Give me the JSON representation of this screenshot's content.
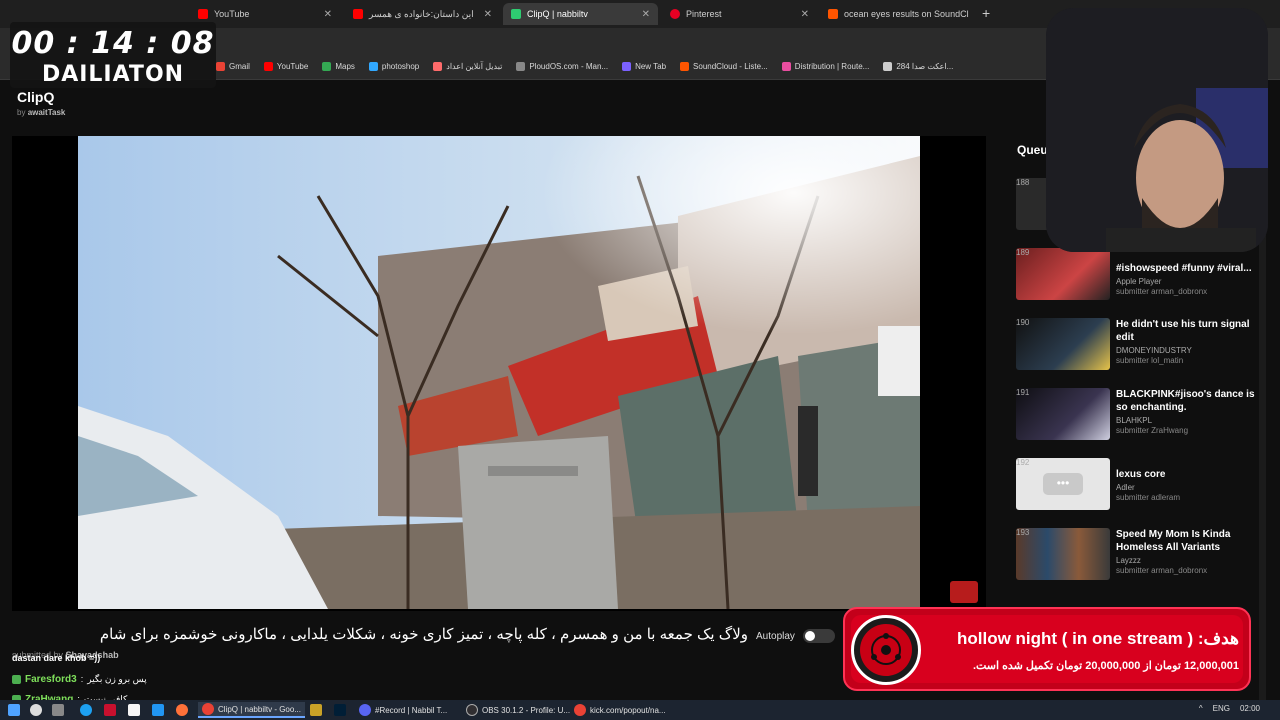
{
  "tabs": [
    {
      "label": "YouTube",
      "color": "#ff0000"
    },
    {
      "label": "این داستان:خانواده ی همسر",
      "color": "#ff0000"
    },
    {
      "label": "ClipQ | nabbiltv",
      "color": "#2ecc71",
      "active": true
    },
    {
      "label": "Pinterest",
      "color": "#e60023"
    },
    {
      "label": "ocean eyes results on SoundCl",
      "color": "#ff5500"
    }
  ],
  "bookmarks": [
    {
      "label": "Gmail",
      "color": "#ea4335"
    },
    {
      "label": "YouTube",
      "color": "#ff0000"
    },
    {
      "label": "Maps",
      "color": "#34a853"
    },
    {
      "label": "photoshop",
      "color": "#31a8ff"
    },
    {
      "label": "تبدیل آنلاین اعداد",
      "color": "#ff6b6b"
    },
    {
      "label": "PloudOS.com - Man...",
      "color": "#888888"
    },
    {
      "label": "New Tab",
      "color": "#7b61ff"
    },
    {
      "label": "SoundCloud - Liste...",
      "color": "#ff5500"
    },
    {
      "label": "Distribution | Route...",
      "color": "#e94ea0"
    },
    {
      "label": "284 اعکت صدا...",
      "color": "#cccccc"
    }
  ],
  "timer": {
    "time": "00 : 14 : 08",
    "label": "DAILIATON"
  },
  "app": {
    "title": "ClipQ",
    "by_prefix": "by",
    "by_user": "awaitTask"
  },
  "video": {
    "title": "ولاگ یک جمعه با من و همسرم ، کله پاچه ، تمیز کاری خونه ، شکلات یلدایی ، ماکارونی خوشمزه برای شام",
    "autoplay_label": "Autoplay",
    "submitted_text": "submitted by",
    "submitted_user": "Shayadshab"
  },
  "chat": [
    {
      "name": "",
      "text": "dastan dare khob =))"
    },
    {
      "name": "Faresford3",
      "text": "پس برو زن بگیر"
    },
    {
      "name": "ZraHwang",
      "text": "کافی نیست"
    }
  ],
  "queue": {
    "title": "Queue",
    "items": [
      {
        "num": "188",
        "title": "",
        "channel": "",
        "submitter": "",
        "thumb": "#2a2a2a"
      },
      {
        "num": "189",
        "title": "#ishowspeed #funny #viral...",
        "channel": "Apple Player",
        "submitter": "submitter arman_dobronx",
        "thumb": "#8a2d2d"
      },
      {
        "num": "190",
        "title": "He didn't use his turn signal edit",
        "channel": "DMONEYINDUSTRY",
        "submitter": "submitter lol_matin",
        "thumb": "#1f2a33"
      },
      {
        "num": "191",
        "title": "BLACKPINK#jisoo's dance is so enchanting.",
        "channel": "BLAHKPL",
        "submitter": "submitter ZraHwang",
        "thumb": "#2b2233"
      },
      {
        "num": "192",
        "title": "lexus core",
        "channel": "Adler",
        "submitter": "submitter adleram",
        "thumb": "#e6e6e6"
      },
      {
        "num": "193",
        "title": "Speed My Mom Is Kinda Homeless All Variants",
        "channel": "Layzzz",
        "submitter": "submitter arman_dobronx",
        "thumb": "#6b4a3a"
      }
    ]
  },
  "banner": {
    "goal": "هدف: ( hollow night ( in one stream",
    "progress": "12,000,001 تومان از 20,000,000 تومان تکمیل شده است."
  },
  "taskbar": {
    "apps": [
      {
        "label": "ClipQ | nabbiltv - Goo...",
        "active": true
      },
      {
        "label": "#Record | Nabbil T...",
        "active": false
      },
      {
        "label": "OBS 30.1.2 - Profile: U...",
        "active": false
      },
      {
        "label": "kick.com/popout/na...",
        "active": false
      }
    ],
    "lang": "ENG",
    "clock": "02:00"
  },
  "colors": {
    "accent": "#2ecc71",
    "banner_red": "#d8001e",
    "chat_name": "#7fe05b"
  }
}
